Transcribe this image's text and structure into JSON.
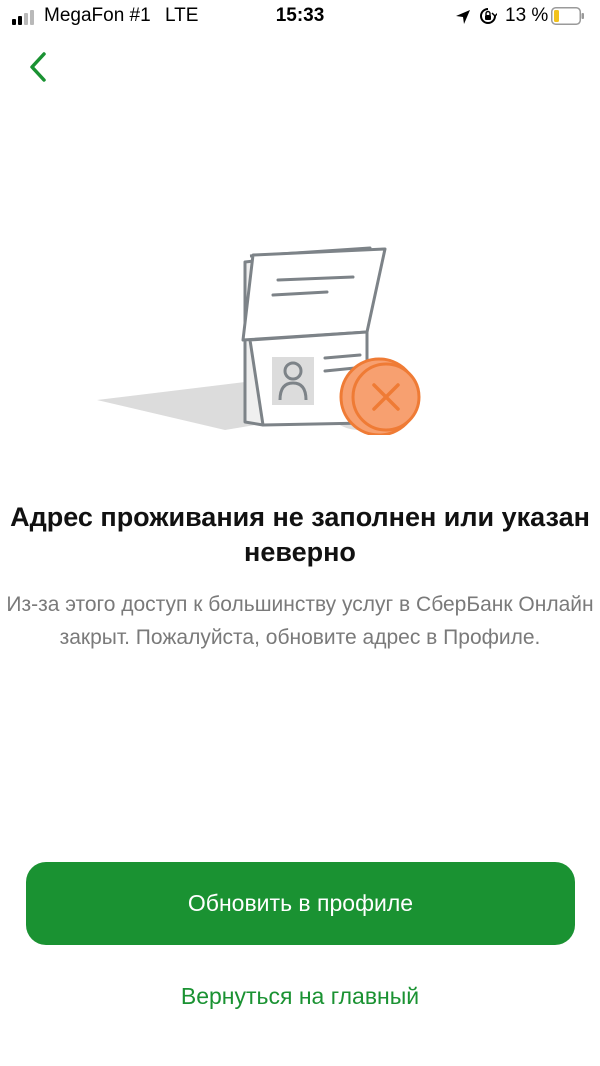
{
  "status_bar": {
    "carrier": "MegaFon #1",
    "network": "LTE",
    "time": "15:33",
    "battery_percent": "13 %",
    "icons": [
      "signal-icon",
      "location-arrow-icon",
      "orientation-lock-icon",
      "battery-icon"
    ]
  },
  "nav": {
    "back_icon": "chevron-left-icon"
  },
  "illustration": {
    "icon": "passport-error-icon"
  },
  "message": {
    "title": "Адрес проживания не заполнен или указан неверно",
    "description": "Из-за этого доступ к большинству услуг в СберБанк Онлайн закрыт. Пожалуйста, обновите адрес в Профиле."
  },
  "actions": {
    "primary_label": "Обновить в профиле",
    "secondary_label": "Вернуться на главный"
  },
  "colors": {
    "accent_green": "#1a9232",
    "error_orange": "#ef7b35",
    "text_secondary": "#7a7a7a"
  }
}
